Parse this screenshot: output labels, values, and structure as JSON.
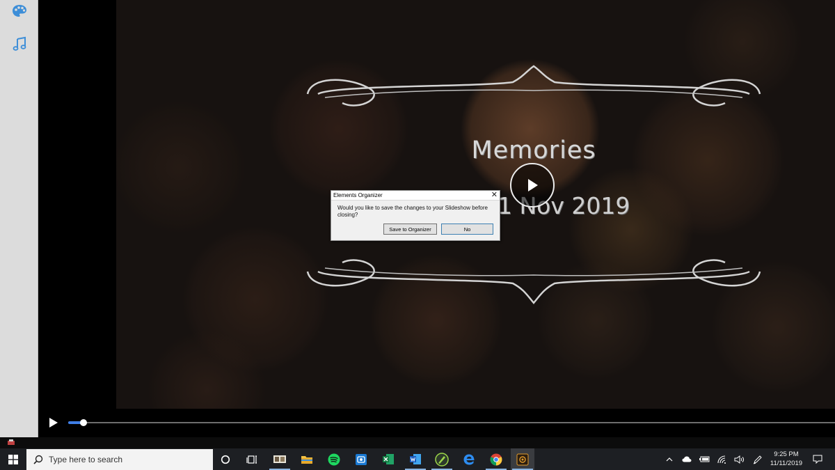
{
  "sidebar": {
    "icons": [
      "palette-icon",
      "music-note-icon"
    ]
  },
  "slide": {
    "title": "Memories",
    "date": "1 Nov 2019"
  },
  "dialog": {
    "title": "Elements Organizer",
    "close_glyph": "✕",
    "message": "Would you like to save the changes to your Slideshow before closing?",
    "save_label": "Save to Organizer",
    "no_label": "No"
  },
  "playback": {
    "progress_fraction": 0.02
  },
  "taskbar": {
    "search_placeholder": "Type here to search",
    "pinned_apps": [
      "task-view",
      "photos-app",
      "file-explorer",
      "spotify",
      "photo-editor",
      "excel",
      "word",
      "pen-app",
      "edge",
      "chrome",
      "elements-organizer"
    ],
    "time": "9:25 PM",
    "date": "11/11/2019"
  },
  "colors": {
    "accent_blue": "#3f7ee6",
    "sidebar_icon_blue": "#3d8ed8",
    "taskbar_bg": "#1d1f23"
  }
}
